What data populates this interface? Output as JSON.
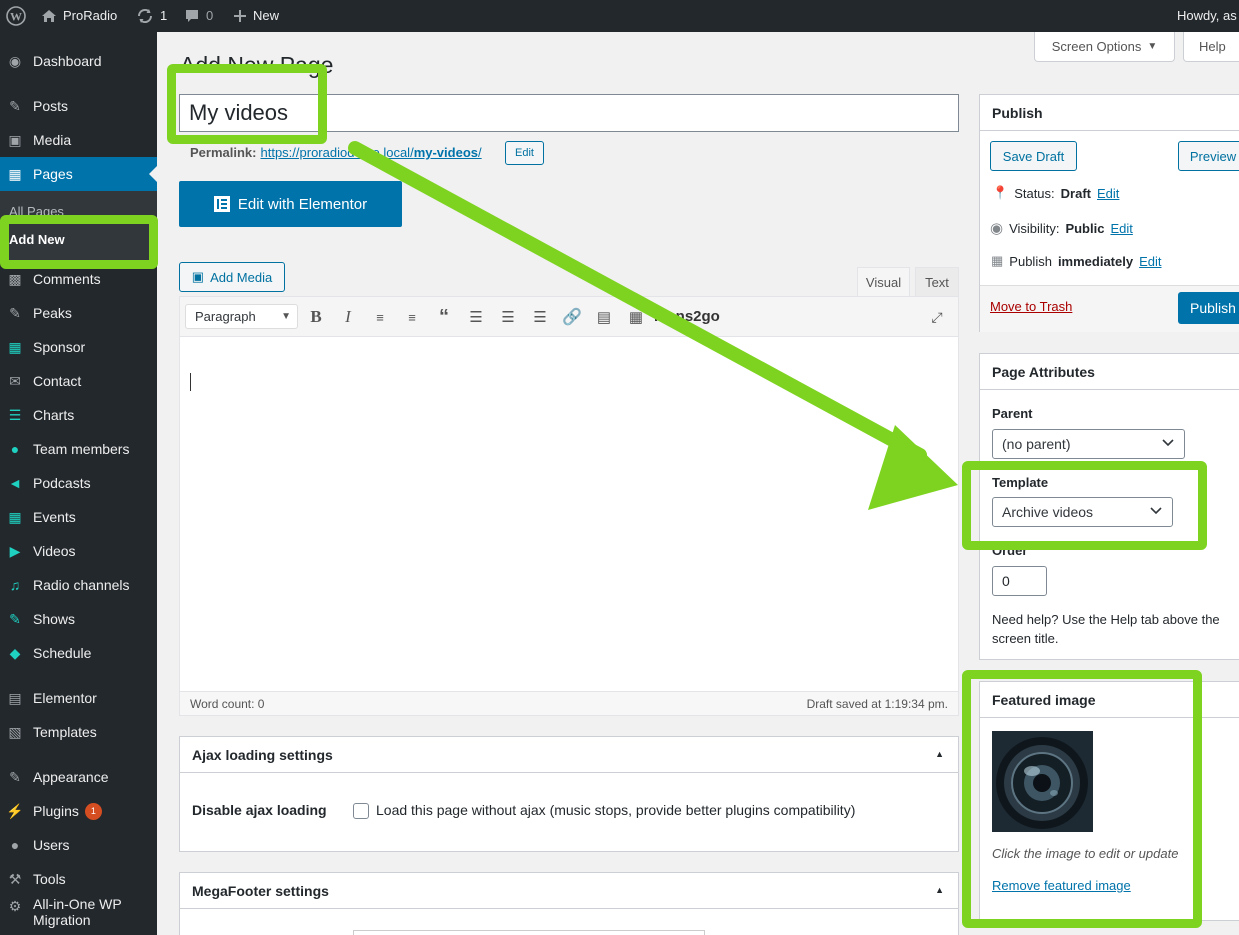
{
  "adminbar": {
    "site_name": "ProRadio",
    "updates_count": "1",
    "comments_count": "0",
    "new_label": "New",
    "howdy": "Howdy, as"
  },
  "sidebar": {
    "items": [
      {
        "label": "Dashboard",
        "icon": "dashboard-icon"
      },
      {
        "label": "Posts",
        "icon": "pin-icon"
      },
      {
        "label": "Media",
        "icon": "media-icon"
      },
      {
        "label": "Pages",
        "icon": "pages-icon"
      },
      {
        "label": "Comments",
        "icon": "comments-icon"
      },
      {
        "label": "Peaks",
        "icon": "pin-icon"
      },
      {
        "label": "Sponsor",
        "icon": "qr-icon"
      },
      {
        "label": "Contact",
        "icon": "mail-icon"
      },
      {
        "label": "Charts",
        "icon": "charts-icon"
      },
      {
        "label": "Team members",
        "icon": "person-icon"
      },
      {
        "label": "Podcasts",
        "icon": "megaphone-icon"
      },
      {
        "label": "Events",
        "icon": "calendar-icon"
      },
      {
        "label": "Videos",
        "icon": "video-icon"
      },
      {
        "label": "Radio channels",
        "icon": "music-file-icon"
      },
      {
        "label": "Shows",
        "icon": "edit-icon"
      },
      {
        "label": "Schedule",
        "icon": "diamond-icon"
      },
      {
        "label": "Elementor",
        "icon": "elementor-icon"
      },
      {
        "label": "Templates",
        "icon": "folder-icon"
      },
      {
        "label": "Appearance",
        "icon": "brush-icon"
      },
      {
        "label": "Plugins",
        "icon": "plug-icon",
        "badge": "1"
      },
      {
        "label": "Users",
        "icon": "users-icon"
      },
      {
        "label": "Tools",
        "icon": "wrench-icon"
      },
      {
        "label": "All-in-One WP Migration",
        "icon": "migration-icon"
      }
    ],
    "submenu": {
      "all_pages": "All Pages",
      "add_new": "Add New"
    }
  },
  "header": {
    "page_heading": "Add New Page",
    "screen_options": "Screen Options",
    "help": "Help"
  },
  "editor": {
    "title_value": "My videos",
    "permalink_label": "Permalink:",
    "permalink_base": "https://proradiodemo.local/",
    "permalink_slug": "my-videos",
    "permalink_trailing": "/",
    "permalink_edit": "Edit",
    "elementor_button": "Edit with Elementor",
    "add_media": "Add Media",
    "tab_visual": "Visual",
    "tab_text": "Text",
    "format_select": "Paragraph",
    "icons2go": "Icons2go",
    "word_count": "Word count: 0",
    "draft_saved": "Draft saved at 1:19:34 pm."
  },
  "ajax_box": {
    "title": "Ajax loading settings",
    "field_label": "Disable ajax loading",
    "checkbox_label": "Load this page without ajax (music stops, provide better plugins compatibility)"
  },
  "megafooter_box": {
    "title": "MegaFooter settings"
  },
  "publish_box": {
    "title": "Publish",
    "save_draft": "Save Draft",
    "preview": "Preview",
    "status_label": "Status:",
    "status_value": "Draft",
    "visibility_label": "Visibility:",
    "visibility_value": "Public",
    "publish_label": "Publish",
    "publish_value": "immediately",
    "edit": "Edit",
    "move_to_trash": "Move to Trash",
    "publish_button": "Publish"
  },
  "attributes_box": {
    "title": "Page Attributes",
    "parent_label": "Parent",
    "parent_value": "(no parent)",
    "template_label": "Template",
    "template_value": "Archive videos",
    "order_label": "Order",
    "order_value": "0",
    "help_text": "Need help? Use the Help tab above the screen title."
  },
  "featured_box": {
    "title": "Featured image",
    "hint": "Click the image to edit or update",
    "remove": "Remove featured image"
  },
  "colors": {
    "accent": "#0073aa",
    "highlight": "#7ed321",
    "sidebar": "#23282d"
  }
}
